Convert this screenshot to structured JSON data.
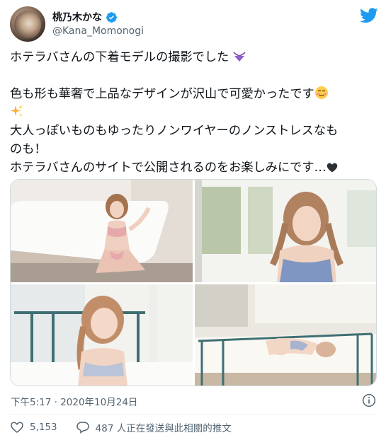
{
  "author": {
    "display_name": "桃乃木かな",
    "handle": "@Kana_Momonogi",
    "verified_icon": "verified-badge-icon"
  },
  "tweet": {
    "line1": "ホテラバさんの下着モデルの撮影でした",
    "line2": "色も形も華奢で上品なデザインが沢山で可愛かったです",
    "line3": "大人っぽいものもゆったりノンワイヤーのノンストレスなも",
    "line4": "のも！",
    "line5": "ホテラバさんのサイトで公開されるのをお楽しみにです…",
    "emojis": [
      "bikini-icon",
      "smiling-face-icon",
      "sparkles-icon",
      "black-heart-icon"
    ]
  },
  "media": {
    "photos": [
      "photo-bathtub",
      "photo-window-portrait",
      "photo-smiling-bed",
      "photo-lying-bed"
    ]
  },
  "meta": {
    "timestamp": "下午5:17 · 2020年10月24日"
  },
  "actions": {
    "like_count": "5,153",
    "reply_label": "487 人正在發送與此相關的推文"
  },
  "colors": {
    "twitter_blue": "#1d9bf0",
    "text_secondary": "#536471",
    "border": "#cfd9de"
  }
}
